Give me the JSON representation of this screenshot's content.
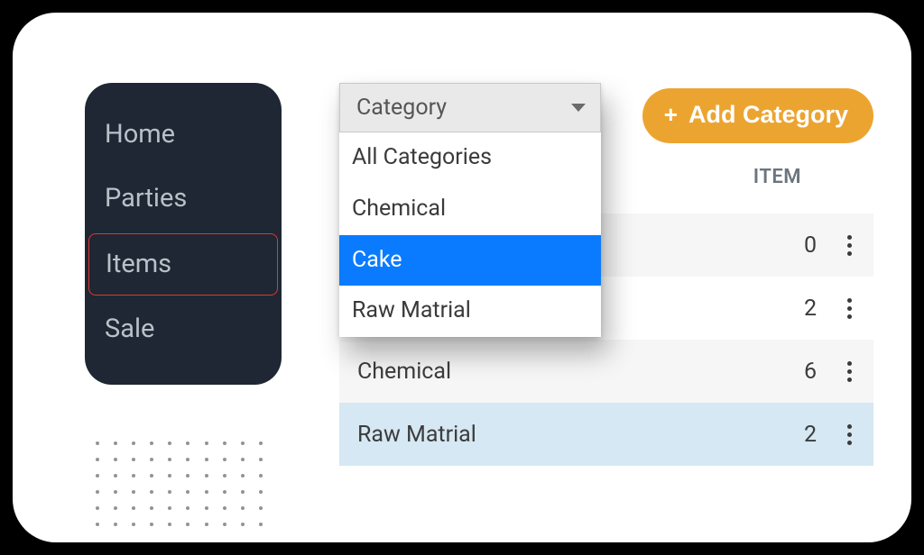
{
  "sidebar": {
    "items": [
      "Home",
      "Parties",
      "Items",
      "Sale"
    ],
    "active_index": 2
  },
  "dropdown": {
    "label": "Category",
    "options": [
      "All Categories",
      "Chemical",
      "Cake",
      "Raw Matrial"
    ],
    "selected_index": 2
  },
  "add_button": {
    "icon": "+",
    "label": "Add Category"
  },
  "table": {
    "header": "ITEM",
    "rows": [
      {
        "name": "",
        "count": 0
      },
      {
        "name": "",
        "count": 2
      },
      {
        "name": "Chemical",
        "count": 6
      },
      {
        "name": "Raw Matrial",
        "count": 2
      }
    ]
  }
}
